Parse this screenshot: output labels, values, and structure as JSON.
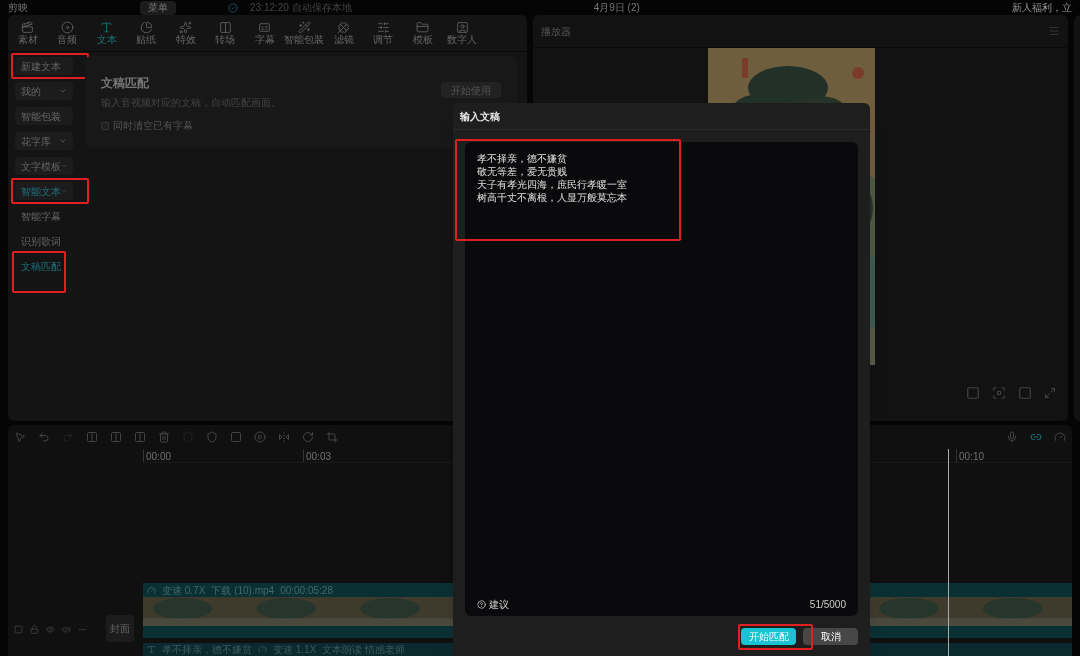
{
  "topbar": {
    "app_name": "剪映",
    "menu": "菜单",
    "autosave": "23:12:20 自动保存本地",
    "project": "4月9日 (2)",
    "promo": "新人福利，立"
  },
  "tabs": [
    {
      "label": "素材",
      "kind": "media",
      "selected": false
    },
    {
      "label": "音频",
      "kind": "audio",
      "selected": false
    },
    {
      "label": "文本",
      "kind": "text",
      "selected": true
    },
    {
      "label": "贴纸",
      "kind": "sticker",
      "selected": false
    },
    {
      "label": "特效",
      "kind": "effect",
      "selected": false
    },
    {
      "label": "转场",
      "kind": "transition",
      "selected": false
    },
    {
      "label": "字幕",
      "kind": "caption",
      "selected": false
    },
    {
      "label": "智能包装",
      "kind": "wand",
      "selected": false
    },
    {
      "label": "滤镜",
      "kind": "filter",
      "selected": false
    },
    {
      "label": "调节",
      "kind": "adjust",
      "selected": false
    },
    {
      "label": "模板",
      "kind": "template",
      "selected": false
    },
    {
      "label": "数字人",
      "kind": "avatar",
      "selected": false
    }
  ],
  "sidebar": [
    {
      "label": "新建文本",
      "kind": "button",
      "selected": false,
      "annotated": true
    },
    {
      "label": "我的",
      "kind": "dropdown",
      "expanded": false,
      "selected": false,
      "annotated": false
    },
    {
      "label": "智能包装",
      "kind": "button",
      "selected": false,
      "annotated": false
    },
    {
      "label": "花字库",
      "kind": "dropdown",
      "expanded": false,
      "selected": false,
      "annotated": false
    },
    {
      "label": "文字模板",
      "kind": "dropdown",
      "expanded": false,
      "selected": false,
      "annotated": false
    },
    {
      "label": "智能文本",
      "kind": "dropdown",
      "expanded": true,
      "selected": true,
      "annotated": true
    },
    {
      "label": "智能字幕",
      "kind": "sub",
      "selected": false,
      "annotated": false
    },
    {
      "label": "识别歌词",
      "kind": "sub",
      "selected": false,
      "annotated": false
    },
    {
      "label": "文稿匹配",
      "kind": "sub",
      "selected": true,
      "annotated": true
    }
  ],
  "content": {
    "title": "文稿匹配",
    "description": "输入音视频对应的文稿，自动匹配画面。",
    "button": "开始使用",
    "checkbox": {
      "label": "同时清空已有字幕",
      "checked": false
    }
  },
  "player": {
    "title": "播放器"
  },
  "timeline": {
    "ticks": [
      "00:00",
      "00:03",
      "00:10"
    ],
    "cover": "封面",
    "video_clip": {
      "speed": "变速 0.7X",
      "file": "下载 (10).mp4",
      "duration": "00:00:05:28"
    },
    "text_clip": {
      "text": "孝不择亲，德不嫌贫",
      "speed": "变速 1.1X",
      "voice": "文本朗读 情感老师"
    }
  },
  "dialog": {
    "title": "输入文稿",
    "lines": [
      "孝不择亲，德不嫌贫",
      "敬无等差，爱无贵贱",
      "天子有孝光四海，庶民行孝暖一室",
      "树高千丈不离根，人显万般莫忘本"
    ],
    "text_annotated": true,
    "hint": "建议",
    "count": "51/5000",
    "confirm": "开始匹配",
    "confirm_annotated": true,
    "cancel": "取消"
  }
}
